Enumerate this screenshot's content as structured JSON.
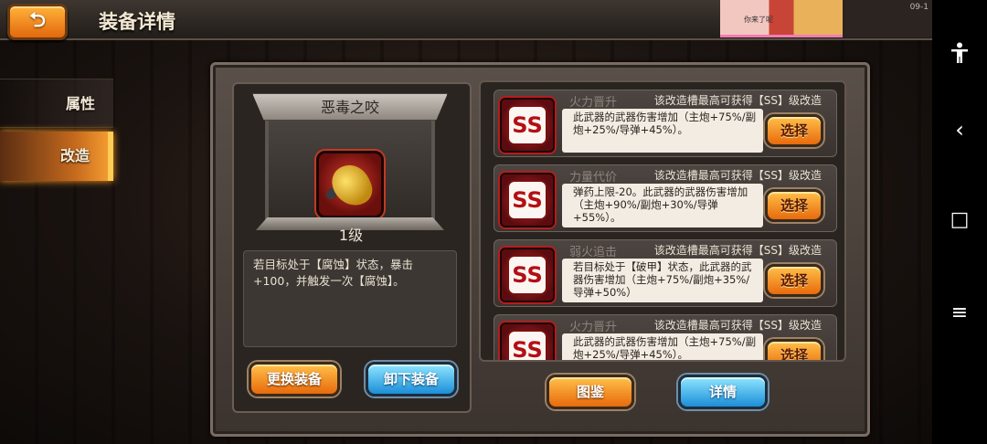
{
  "header": {
    "back_label": "⮌",
    "title": "装备详情",
    "overlay_caption": "你来了呢",
    "clock": "09-1"
  },
  "tabs": [
    {
      "label": "属性",
      "active": false
    },
    {
      "label": "改造",
      "active": true
    }
  ],
  "equipment": {
    "name": "恶毒之咬",
    "level": "1级",
    "description": "若目标处于【腐蚀】状态，暴击+100，并触发一次【腐蚀】。",
    "buttons": {
      "replace": "更换装备",
      "unequip": "卸下装备"
    }
  },
  "slots": [
    {
      "badge": "SS",
      "name": "火力晋升",
      "hint": "该改造槽最高可获得【SS】级改造",
      "desc": "此武器的武器伤害增加（主炮+75%/副炮+25%/导弹+45%）。",
      "button": "选择"
    },
    {
      "badge": "SS",
      "name": "力量代价",
      "hint": "该改造槽最高可获得【SS】级改造",
      "desc": "弹药上限-20。此武器的武器伤害增加（主炮+90%/副炮+30%/导弹+55%）。",
      "button": "选择"
    },
    {
      "badge": "SS",
      "name": "弱火追击",
      "hint": "该改造槽最高可获得【SS】级改造",
      "desc": "若目标处于【破甲】状态，此武器的武器伤害增加（主炮+75%/副炮+35%/导弹+50%）",
      "button": "选择"
    },
    {
      "badge": "SS",
      "name": "火力晋升",
      "hint": "该改造槽最高可获得【SS】级改造",
      "desc": "此武器的武器伤害增加（主炮+75%/副炮+25%/导弹+45%）。",
      "button": "选择"
    }
  ],
  "bottom_buttons": {
    "codex": "图鉴",
    "details": "详情"
  },
  "system_nav": {
    "accessibility": "accessibility-icon",
    "back": "‹",
    "home": "□",
    "recents": "≡"
  },
  "colors": {
    "accent_orange": "#e86a0c",
    "accent_blue": "#1b8ed8",
    "slot_red": "#b30f14"
  }
}
